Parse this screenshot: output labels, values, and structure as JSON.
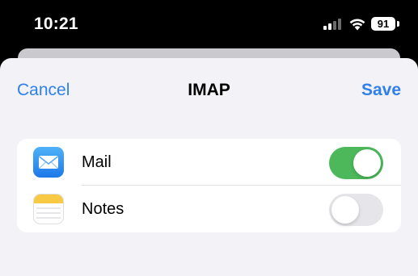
{
  "status_bar": {
    "time": "10:21",
    "battery": "91",
    "icons": [
      "signal-icon",
      "wifi-icon",
      "battery-icon"
    ]
  },
  "nav": {
    "cancel_label": "Cancel",
    "title": "IMAP",
    "save_label": "Save"
  },
  "list": {
    "items": [
      {
        "label": "Mail",
        "icon": "mail-app-icon",
        "enabled": true
      },
      {
        "label": "Notes",
        "icon": "notes-app-icon",
        "enabled": false
      }
    ]
  },
  "colors": {
    "accent": "#2f80ed",
    "toggle_on": "#4cb85a",
    "toggle_off": "#e6e6ea",
    "sheet_background": "#f2f2f7"
  }
}
